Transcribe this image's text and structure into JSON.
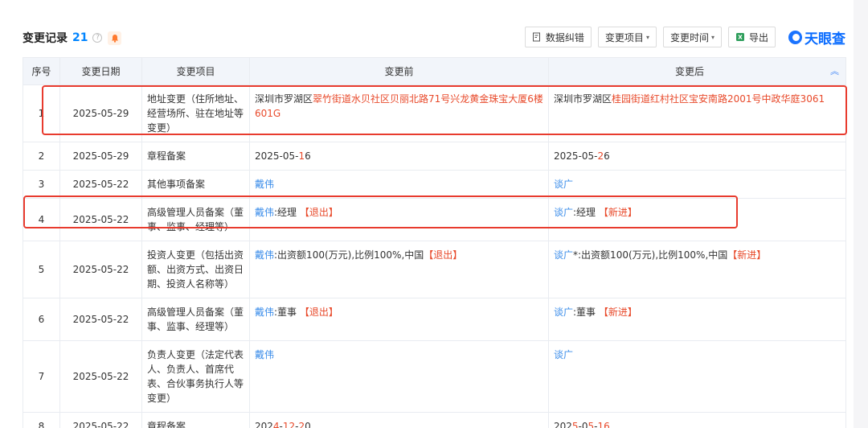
{
  "header": {
    "title": "变更记录",
    "count": "21",
    "help_glyph": "?",
    "icons": {
      "help": "question-circle-icon",
      "bell": "bell-icon"
    },
    "buttons": {
      "correction": "数据纠错",
      "change_item": "变更项目",
      "change_time": "变更时间",
      "export": "导出"
    },
    "logo_text": "天眼查"
  },
  "table": {
    "columns": [
      "序号",
      "变更日期",
      "变更项目",
      "变更前",
      "变更后"
    ],
    "rows": [
      {
        "idx": "1",
        "date": "2025-05-29",
        "item": "地址变更（住所地址、经营场所、驻在地址等变更）",
        "before": [
          {
            "t": "深圳市罗湖区",
            "c": ""
          },
          {
            "t": "翠竹街道水贝社区贝丽北路71号兴龙黄金珠宝大厦6楼601G",
            "c": "red"
          }
        ],
        "after": [
          {
            "t": "深圳市罗湖区",
            "c": ""
          },
          {
            "t": "桂园街道红村社区宝安南路2001号中政华庭3061",
            "c": "red"
          }
        ]
      },
      {
        "idx": "2",
        "date": "2025-05-29",
        "item": "章程备案",
        "before": [
          {
            "t": "2025-05-",
            "c": ""
          },
          {
            "t": "1",
            "c": "red"
          },
          {
            "t": "6",
            "c": ""
          }
        ],
        "after": [
          {
            "t": "2025-05-",
            "c": ""
          },
          {
            "t": "2",
            "c": "red"
          },
          {
            "t": "6",
            "c": ""
          }
        ]
      },
      {
        "idx": "3",
        "date": "2025-05-22",
        "item": "其他事项备案",
        "before": [
          {
            "t": "戴伟",
            "c": "blue"
          }
        ],
        "after": [
          {
            "t": "谈广",
            "c": "blue"
          }
        ]
      },
      {
        "idx": "4",
        "date": "2025-05-22",
        "item": "高级管理人员备案（董事、监事、经理等）",
        "before": [
          {
            "t": "戴伟",
            "c": "blue"
          },
          {
            "t": ":经理 ",
            "c": ""
          },
          {
            "t": "【退出】",
            "c": "red"
          }
        ],
        "after": [
          {
            "t": "谈广",
            "c": "blue"
          },
          {
            "t": ":经理 ",
            "c": ""
          },
          {
            "t": "【新进】",
            "c": "red"
          }
        ]
      },
      {
        "idx": "5",
        "date": "2025-05-22",
        "item": "投资人变更（包括出资额、出资方式、出资日期、投资人名称等）",
        "before": [
          {
            "t": "戴伟",
            "c": "blue"
          },
          {
            "t": ":出资额100(万元),比例100%,中国",
            "c": ""
          },
          {
            "t": "【退出】",
            "c": "red"
          }
        ],
        "after": [
          {
            "t": "谈广",
            "c": "blue"
          },
          {
            "t": "*:出资额100(万元),比例100%,中国",
            "c": ""
          },
          {
            "t": "【新进】",
            "c": "red"
          }
        ]
      },
      {
        "idx": "6",
        "date": "2025-05-22",
        "item": "高级管理人员备案（董事、监事、经理等）",
        "before": [
          {
            "t": "戴伟",
            "c": "blue"
          },
          {
            "t": ":董事 ",
            "c": ""
          },
          {
            "t": "【退出】",
            "c": "red"
          }
        ],
        "after": [
          {
            "t": "谈广",
            "c": "blue"
          },
          {
            "t": ":董事 ",
            "c": ""
          },
          {
            "t": "【新进】",
            "c": "red"
          }
        ]
      },
      {
        "idx": "7",
        "date": "2025-05-22",
        "item": "负责人变更（法定代表人、负责人、首席代表、合伙事务执行人等变更）",
        "before": [
          {
            "t": "戴伟",
            "c": "blue"
          }
        ],
        "after": [
          {
            "t": "谈广",
            "c": "blue"
          }
        ]
      },
      {
        "idx": "8",
        "date": "2025-05-22",
        "item": "章程备案",
        "before": [
          {
            "t": "202",
            "c": ""
          },
          {
            "t": "4",
            "c": "red"
          },
          {
            "t": "-",
            "c": ""
          },
          {
            "t": "12",
            "c": "red"
          },
          {
            "t": "-",
            "c": ""
          },
          {
            "t": "2",
            "c": "red"
          },
          {
            "t": "0",
            "c": ""
          }
        ],
        "after": [
          {
            "t": "202",
            "c": ""
          },
          {
            "t": "5",
            "c": "red"
          },
          {
            "t": "-0",
            "c": ""
          },
          {
            "t": "5",
            "c": "red"
          },
          {
            "t": "-",
            "c": ""
          },
          {
            "t": "16",
            "c": "red"
          }
        ]
      }
    ]
  },
  "colors": {
    "accent_blue": "#3b8dea",
    "highlight_red": "#e8492a",
    "annotation_box": "#e83b2e"
  }
}
